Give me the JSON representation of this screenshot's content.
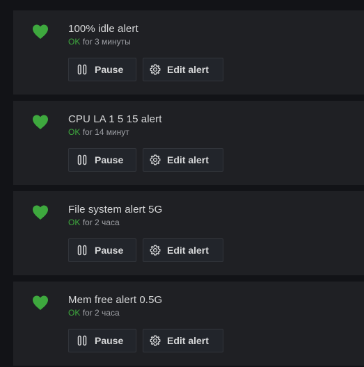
{
  "alerts": [
    {
      "name": "100% idle alert",
      "state": "OK",
      "duration": "for 3 минуты",
      "pause_label": "Pause",
      "edit_label": "Edit alert"
    },
    {
      "name": "CPU LA 1 5 15 alert",
      "state": "OK",
      "duration": "for 14 минут",
      "pause_label": "Pause",
      "edit_label": "Edit alert"
    },
    {
      "name": "File system alert 5G",
      "state": "OK",
      "duration": "for 2 часа",
      "pause_label": "Pause",
      "edit_label": "Edit alert"
    },
    {
      "name": "Mem free alert 0.5G",
      "state": "OK",
      "duration": "for 2 часа",
      "pause_label": "Pause",
      "edit_label": "Edit alert"
    }
  ],
  "icons": {
    "state": "heart-icon",
    "pause": "pause-icon",
    "edit": "gear-icon"
  },
  "colors": {
    "ok": "#3ea83e",
    "heart": "#3ea83e",
    "card": "#1f2024",
    "background": "#121317"
  }
}
